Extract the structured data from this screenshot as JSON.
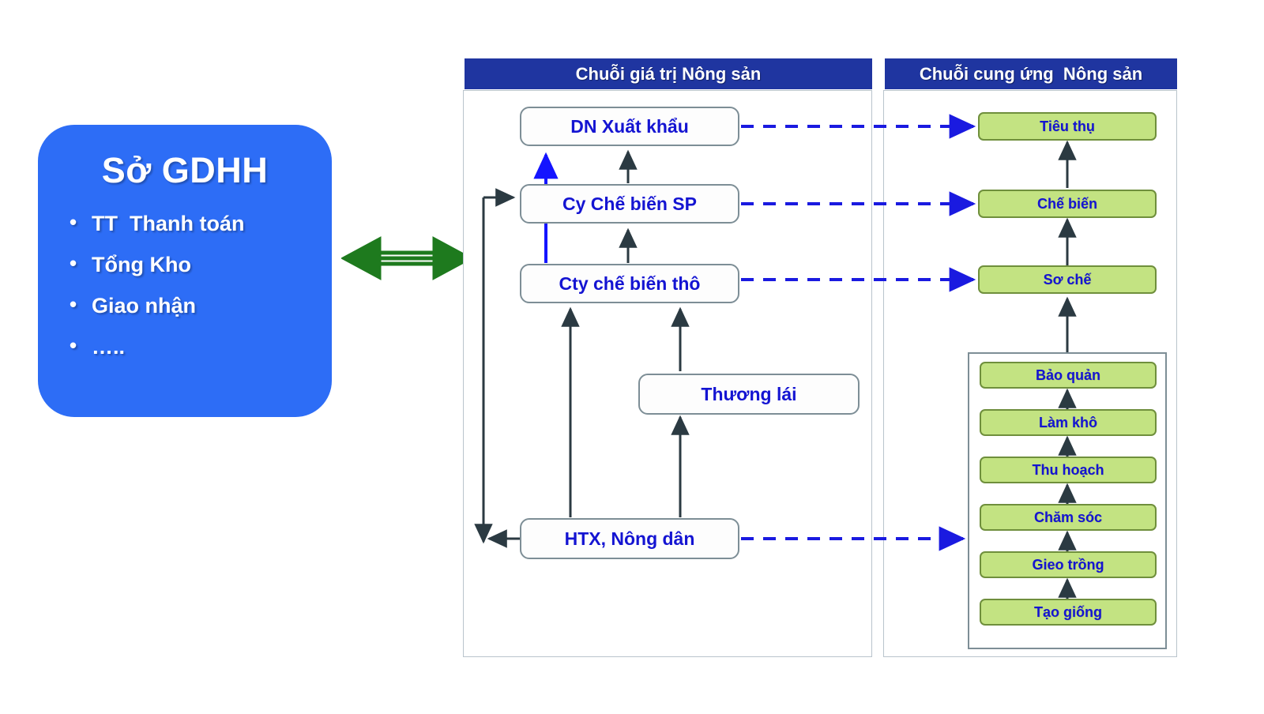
{
  "left_card": {
    "title": "Sở GDHH",
    "bullets": [
      {
        "label": "TT  Thanh toán"
      },
      {
        "label": "Tổng Kho"
      },
      {
        "label": "Giao nhận"
      },
      {
        "label": "….."
      }
    ]
  },
  "connector": {
    "green_double_arrow_color": "#1e7a1e",
    "name": "bidirectional-link"
  },
  "panels": [
    {
      "id": "value_chain",
      "title": "Chuỗi giá trị Nông sản",
      "header_color": "#1f35a0",
      "nodes": [
        {
          "id": "dn_xuat_khau",
          "label": "DN Xuất khẩu"
        },
        {
          "id": "cy_che_bien_sp",
          "label": "Cy Chế biến SP"
        },
        {
          "id": "cty_che_bien_tho",
          "label": "Cty chế biến thô"
        },
        {
          "id": "thuong_lai",
          "label": "Thương lái"
        },
        {
          "id": "htx_nong_dan",
          "label": "HTX, Nông dân"
        }
      ]
    },
    {
      "id": "supply_chain",
      "title": "Chuỗi cung ứng  Nông sản",
      "header_color": "#1f35a0",
      "nodes": [
        {
          "id": "tieu_thu",
          "label": "Tiêu thụ"
        },
        {
          "id": "che_bien",
          "label": "Chế biến"
        },
        {
          "id": "so_che",
          "label": "Sơ chế"
        }
      ],
      "cultivation_group": {
        "nodes": [
          {
            "id": "bao_quan",
            "label": "Bảo quản"
          },
          {
            "id": "lam_kho",
            "label": "Làm khô"
          },
          {
            "id": "thu_hoach",
            "label": "Thu hoạch"
          },
          {
            "id": "cham_soc",
            "label": "Chăm sóc"
          },
          {
            "id": "gieo_trong",
            "label": "Gieo trồng"
          },
          {
            "id": "tao_giong",
            "label": "Tạo giống"
          }
        ]
      }
    }
  ],
  "colors": {
    "brand_blue": "#2d6df6",
    "header_blue": "#1f35a0",
    "node_text_blue": "#1414d2",
    "green_fill": "#c3e382",
    "green_border": "#6f8f3c",
    "dashed_link": "#1a1ae0",
    "solid_link": "#2b3a42",
    "vertical_highlight": "#1414ff"
  },
  "links": {
    "dashed_mappings": [
      {
        "from": "dn_xuat_khau",
        "to": "tieu_thu"
      },
      {
        "from": "cy_che_bien_sp",
        "to": "che_bien"
      },
      {
        "from": "cty_che_bien_tho",
        "to": "so_che"
      },
      {
        "from": "htx_nong_dan",
        "to": "cultivation_group"
      }
    ]
  }
}
